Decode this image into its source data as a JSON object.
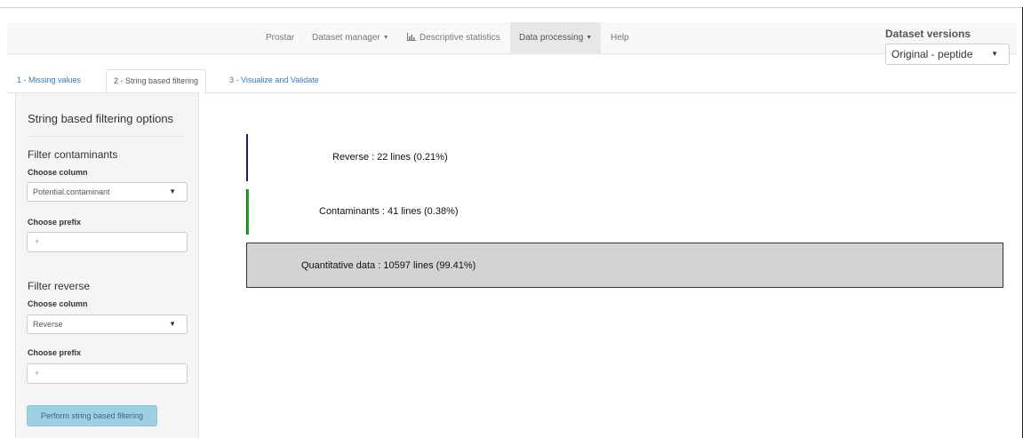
{
  "navbar": {
    "items": [
      {
        "label": "Prostar"
      },
      {
        "label": "Dataset manager"
      },
      {
        "label": "Descriptive statistics"
      },
      {
        "label": "Data processing"
      },
      {
        "label": "Help"
      }
    ]
  },
  "dataset_versions": {
    "title": "Dataset versions",
    "selected": "Original - peptide"
  },
  "tabs": [
    {
      "label": "1 - Missing values"
    },
    {
      "label": "2 - String based filtering"
    },
    {
      "label": "3 - Visualize and Validate"
    }
  ],
  "sidebar": {
    "title": "String based filtering options",
    "contaminants": {
      "heading": "Filter contaminants",
      "column_label": "Choose column",
      "column_value": "Potential.contaminant",
      "prefix_label": "Choose prefix",
      "prefix_value": "+"
    },
    "reverse": {
      "heading": "Filter reverse",
      "column_label": "Choose column",
      "column_value": "Reverse",
      "prefix_label": "Choose prefix",
      "prefix_value": "+"
    },
    "button_label": "Perform string based filtering"
  },
  "summary": {
    "reverse": "Reverse : 22 lines (0.21%)",
    "contaminants": "Contaminants : 41 lines (0.38%)",
    "quantitative": "Quantitative data : 10597 lines (99.41%)",
    "reverse_color": "#1a1a6e",
    "contaminants_color": "#22aa22",
    "quantitative_color": "#d3d3d3"
  }
}
